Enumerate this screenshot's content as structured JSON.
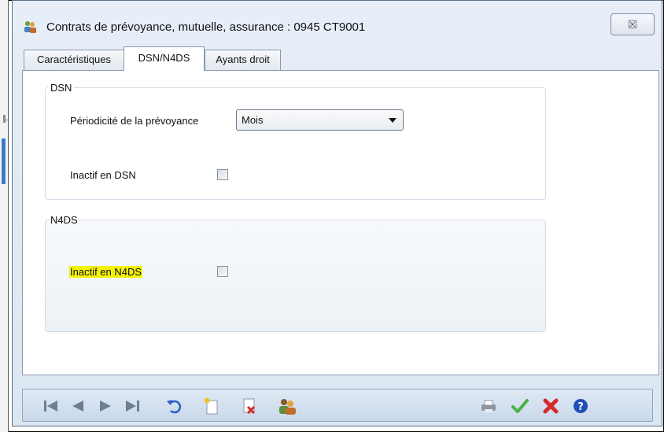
{
  "window": {
    "title": "Contrats de prévoyance, mutuelle, assurance : 0945 CT9001",
    "close_glyph": "☒"
  },
  "tabs": [
    {
      "label": "Caractéristiques",
      "active": false
    },
    {
      "label": "DSN/N4DS",
      "active": true
    },
    {
      "label": "Ayants droit",
      "active": false
    }
  ],
  "dsn": {
    "title": "DSN",
    "periodicite_label": "Périodicité de la prévoyance",
    "periodicite_value": "Mois",
    "inactif_label": "Inactif en DSN",
    "inactif_checked": false
  },
  "n4ds": {
    "title": "N4DS",
    "inactif_label": "Inactif en N4DS",
    "inactif_checked": false,
    "highlight_color": "#f4f20c"
  },
  "toolbar": {
    "buttons": [
      {
        "icon": "first-record-icon"
      },
      {
        "icon": "previous-record-icon"
      },
      {
        "icon": "next-record-icon"
      },
      {
        "icon": "last-record-icon"
      },
      {
        "icon": "undo-icon"
      },
      {
        "icon": "new-document-icon"
      },
      {
        "icon": "delete-document-icon"
      },
      {
        "icon": "users-icon"
      },
      {
        "icon": "print-icon"
      },
      {
        "icon": "validate-check-icon"
      },
      {
        "icon": "cancel-x-icon"
      },
      {
        "icon": "help-icon"
      }
    ]
  },
  "colors": {
    "accent_blue": "#3b7ac9",
    "check_green": "#46b245",
    "cancel_red": "#d62b2b",
    "help_blue": "#1f4fb8"
  }
}
